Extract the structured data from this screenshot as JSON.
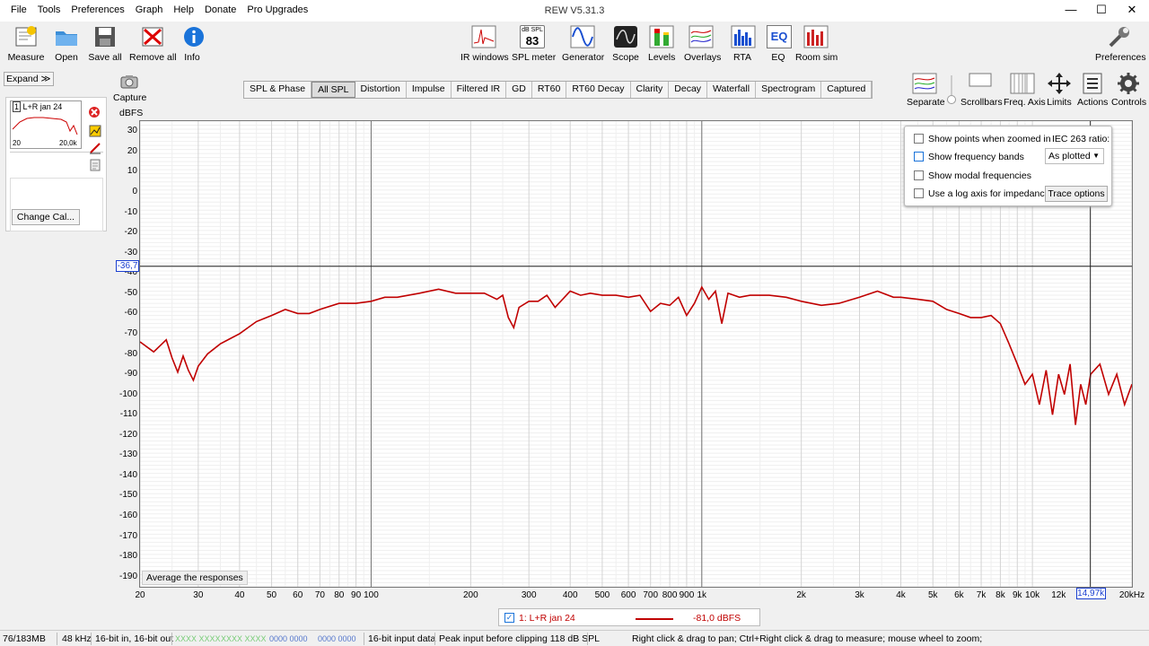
{
  "window": {
    "title": "REW V5.31.3",
    "minimize": "—",
    "maximize": "☐",
    "close": "✕"
  },
  "menu": [
    "File",
    "Tools",
    "Preferences",
    "Graph",
    "Help",
    "Donate",
    "Pro Upgrades"
  ],
  "toolbar_left": [
    {
      "label": "Measure",
      "icon": "measure-icon"
    },
    {
      "label": "Open",
      "icon": "folder-icon"
    },
    {
      "label": "Save all",
      "icon": "save-icon"
    },
    {
      "label": "Remove all",
      "icon": "remove-icon"
    },
    {
      "label": "Info",
      "icon": "info-icon"
    }
  ],
  "toolbar_center": [
    {
      "label": "IR windows",
      "icon": "ir-windows-icon"
    },
    {
      "label": "SPL meter",
      "icon": "spl-meter-icon",
      "badge_top": "dB SPL",
      "badge_value": "83"
    },
    {
      "label": "Generator",
      "icon": "generator-icon"
    },
    {
      "label": "Scope",
      "icon": "scope-icon"
    },
    {
      "label": "Levels",
      "icon": "levels-icon"
    },
    {
      "label": "Overlays",
      "icon": "overlays-icon"
    },
    {
      "label": "RTA",
      "icon": "rta-icon"
    },
    {
      "label": "EQ",
      "icon": "eq-icon",
      "badge_value": "EQ"
    },
    {
      "label": "Room sim",
      "icon": "room-sim-icon"
    }
  ],
  "toolbar_right": {
    "label": "Preferences",
    "icon": "wrench-icon"
  },
  "left_panel": {
    "expand_label": "Expand",
    "expand_chevrons": "≫",
    "measurement": {
      "index": "1",
      "name": "L+R jan 24",
      "thumb_x_start": "20",
      "thumb_x_end": "20,0k"
    },
    "change_cal_label": "Change Cal...",
    "capture_label": "Capture"
  },
  "tabs": [
    "SPL & Phase",
    "All SPL",
    "Distortion",
    "Impulse",
    "Filtered IR",
    "GD",
    "RT60",
    "RT60 Decay",
    "Clarity",
    "Decay",
    "Waterfall",
    "Spectrogram",
    "Captured"
  ],
  "active_tab": "All SPL",
  "right_tools": [
    "Separate",
    "Scrollbars",
    "Freq. Axis",
    "Limits",
    "Actions",
    "Controls"
  ],
  "graph": {
    "y_unit": "dBFS",
    "cursor_y_label": "-36,7",
    "cursor_x_label": "14,97k",
    "average_button": "Average the responses"
  },
  "options_panel": {
    "show_points": "Show points when zoomed in",
    "iec_label": "IEC 263 ratio:",
    "show_bands": "Show frequency bands",
    "as_plotted": "As plotted",
    "show_modal": "Show modal frequencies",
    "log_axis": "Use a log axis for impedance",
    "trace_options": "Trace options"
  },
  "legend": {
    "label": "1: L+R jan 24",
    "value": "-81,0 dBFS",
    "color": "#c00000"
  },
  "status": {
    "memory": "76/183MB",
    "rate": "48 kHz",
    "bits": "16-bit in, 16-bit out",
    "in_level": "XXXX XXXX",
    "out_level": "XXXX XXXX",
    "in_zero": "0000 0000",
    "out_zero": "0000 0000",
    "input_data": "16-bit input data",
    "peak": "Peak input before clipping 118 dB SPL",
    "hint": "Right click & drag to pan; Ctrl+Right click & drag to measure; mouse wheel to zoom;"
  },
  "chart_data": {
    "type": "line",
    "title": "",
    "xlabel": "",
    "ylabel": "dBFS",
    "xscale": "log",
    "xlim": [
      20,
      20000
    ],
    "ylim": [
      -195,
      35
    ],
    "y_ticks": [
      30,
      20,
      10,
      0,
      -10,
      -20,
      -30,
      -40,
      -50,
      -60,
      -70,
      -80,
      -90,
      -100,
      -110,
      -120,
      -130,
      -140,
      -150,
      -160,
      -170,
      -180,
      -190
    ],
    "x_ticks": [
      {
        "v": 20,
        "t": "20"
      },
      {
        "v": 30,
        "t": "30"
      },
      {
        "v": 40,
        "t": "40"
      },
      {
        "v": 50,
        "t": "50"
      },
      {
        "v": 60,
        "t": "60"
      },
      {
        "v": 70,
        "t": "70"
      },
      {
        "v": 80,
        "t": "80"
      },
      {
        "v": 90,
        "t": "90"
      },
      {
        "v": 100,
        "t": "100"
      },
      {
        "v": 200,
        "t": "200"
      },
      {
        "v": 300,
        "t": "300"
      },
      {
        "v": 400,
        "t": "400"
      },
      {
        "v": 500,
        "t": "500"
      },
      {
        "v": 600,
        "t": "600"
      },
      {
        "v": 700,
        "t": "700"
      },
      {
        "v": 800,
        "t": "800"
      },
      {
        "v": 900,
        "t": "900"
      },
      {
        "v": 1000,
        "t": "1k"
      },
      {
        "v": 2000,
        "t": "2k"
      },
      {
        "v": 3000,
        "t": "3k"
      },
      {
        "v": 4000,
        "t": "4k"
      },
      {
        "v": 5000,
        "t": "5k"
      },
      {
        "v": 6000,
        "t": "6k"
      },
      {
        "v": 7000,
        "t": "7k"
      },
      {
        "v": 8000,
        "t": "8k"
      },
      {
        "v": 9000,
        "t": "9k"
      },
      {
        "v": 10000,
        "t": "10k"
      },
      {
        "v": 12000,
        "t": "12k"
      },
      {
        "v": 20000,
        "t": "20kHz"
      }
    ],
    "cursor": {
      "x": 14970,
      "y": -36.7
    },
    "grid": true,
    "series": [
      {
        "color": "#c00000",
        "x": [
          20,
          22,
          24,
          25,
          26,
          27,
          28,
          29,
          30,
          32,
          35,
          40,
          45,
          50,
          55,
          60,
          65,
          70,
          80,
          90,
          100,
          110,
          120,
          140,
          160,
          180,
          200,
          220,
          240,
          250,
          260,
          270,
          280,
          300,
          320,
          340,
          360,
          400,
          430,
          460,
          500,
          550,
          600,
          650,
          700,
          750,
          800,
          850,
          900,
          950,
          1000,
          1050,
          1100,
          1150,
          1200,
          1300,
          1400,
          1600,
          1800,
          2000,
          2300,
          2600,
          3000,
          3400,
          3800,
          4000,
          4500,
          5000,
          5500,
          6000,
          6500,
          7000,
          7500,
          8000,
          8500,
          9000,
          9500,
          10000,
          10500,
          11000,
          11500,
          12000,
          12500,
          13000,
          13500,
          14000,
          14500,
          15000,
          16000,
          17000,
          18000,
          19000,
          20000
        ],
        "y": [
          -74,
          -79,
          -73,
          -82,
          -89,
          -81,
          -88,
          -93,
          -86,
          -80,
          -75,
          -70,
          -64,
          -61,
          -58,
          -60,
          -60,
          -58,
          -55,
          -55,
          -54,
          -52,
          -52,
          -50,
          -48,
          -50,
          -50,
          -50,
          -53,
          -51,
          -62,
          -67,
          -57,
          -54,
          -54,
          -51,
          -57,
          -49,
          -51,
          -50,
          -51,
          -51,
          -52,
          -51,
          -59,
          -55,
          -56,
          -52,
          -61,
          -55,
          -47,
          -53,
          -49,
          -65,
          -50,
          -52,
          -51,
          -51,
          -52,
          -54,
          -56,
          -55,
          -52,
          -49,
          -52,
          -52,
          -53,
          -54,
          -58,
          -60,
          -62,
          -62,
          -61,
          -65,
          -75,
          -85,
          -95,
          -90,
          -105,
          -88,
          -110,
          -90,
          -100,
          -85,
          -115,
          -95,
          -105,
          -90,
          -85,
          -100,
          -90,
          -105,
          -95
        ]
      }
    ]
  }
}
